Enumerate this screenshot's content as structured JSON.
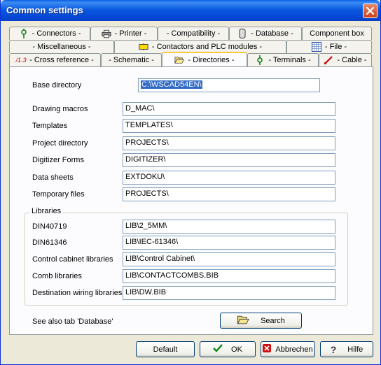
{
  "window": {
    "title": "Common settings"
  },
  "tabs": {
    "row1": [
      {
        "label": "- Connectors -",
        "icon": "connector-icon"
      },
      {
        "label": "- Printer -",
        "icon": "printer-icon"
      },
      {
        "label": "- Compatibility -",
        "icon": ""
      },
      {
        "label": "- Database -",
        "icon": "database-icon"
      },
      {
        "label": "Component box",
        "icon": ""
      }
    ],
    "row2": [
      {
        "label": "- Miscellaneous -",
        "icon": ""
      },
      {
        "label": "- Contactors and PLC modules -",
        "icon": "contactor-icon"
      },
      {
        "label": "- File -",
        "icon": "grid-file-icon"
      }
    ],
    "row3": [
      {
        "label": "- Cross reference -",
        "icon": "cross-reference-icon",
        "icon_text": "/1.3"
      },
      {
        "label": "- Schematic -",
        "icon": ""
      },
      {
        "label": "- Directories -",
        "icon": "folder-open-icon"
      },
      {
        "label": "- Terminals -",
        "icon": "terminal-icon"
      },
      {
        "label": "- Cable -",
        "icon": "cable-icon"
      }
    ]
  },
  "directories": {
    "base_label": "Base directory",
    "base_value": "C:\\WSCAD54EN\\",
    "fields": [
      {
        "label": "Drawing macros",
        "value": "D_MAC\\"
      },
      {
        "label": "Templates",
        "value": "TEMPLATES\\"
      },
      {
        "label": "Project directory",
        "value": "PROJECTS\\"
      },
      {
        "label": "Digitizer Forms",
        "value": "DIGITIZER\\"
      },
      {
        "label": "Data sheets",
        "value": "EXTDOKU\\"
      },
      {
        "label": "Temporary files",
        "value": "PROJECTS\\"
      }
    ]
  },
  "libraries": {
    "title": "Libraries",
    "fields": [
      {
        "label": "DIN40719",
        "value": "LIB\\2_5MM\\"
      },
      {
        "label": "DIN61346",
        "value": "LIB\\IEC-61346\\"
      },
      {
        "label": "Control cabinet libraries",
        "value": "LIB\\Control Cabinet\\"
      },
      {
        "label": "Comb libraries",
        "value": "LIB\\CONTACTCOMBS.BIB"
      },
      {
        "label": "Destination wiring libraries",
        "value": "LIB\\DW.BIB"
      }
    ]
  },
  "see_also": "See also tab 'Database'",
  "search_button": {
    "label": "Search",
    "icon": "folder-open-icon"
  },
  "footer": {
    "default_label": "Default",
    "ok_label": "OK",
    "cancel_label": "Abbrechen",
    "help_label": "Hilfe"
  },
  "colors": {
    "titlebar": "#0a5fe6",
    "tab_highlight": "#ffc83c",
    "selection": "#316ac5"
  }
}
